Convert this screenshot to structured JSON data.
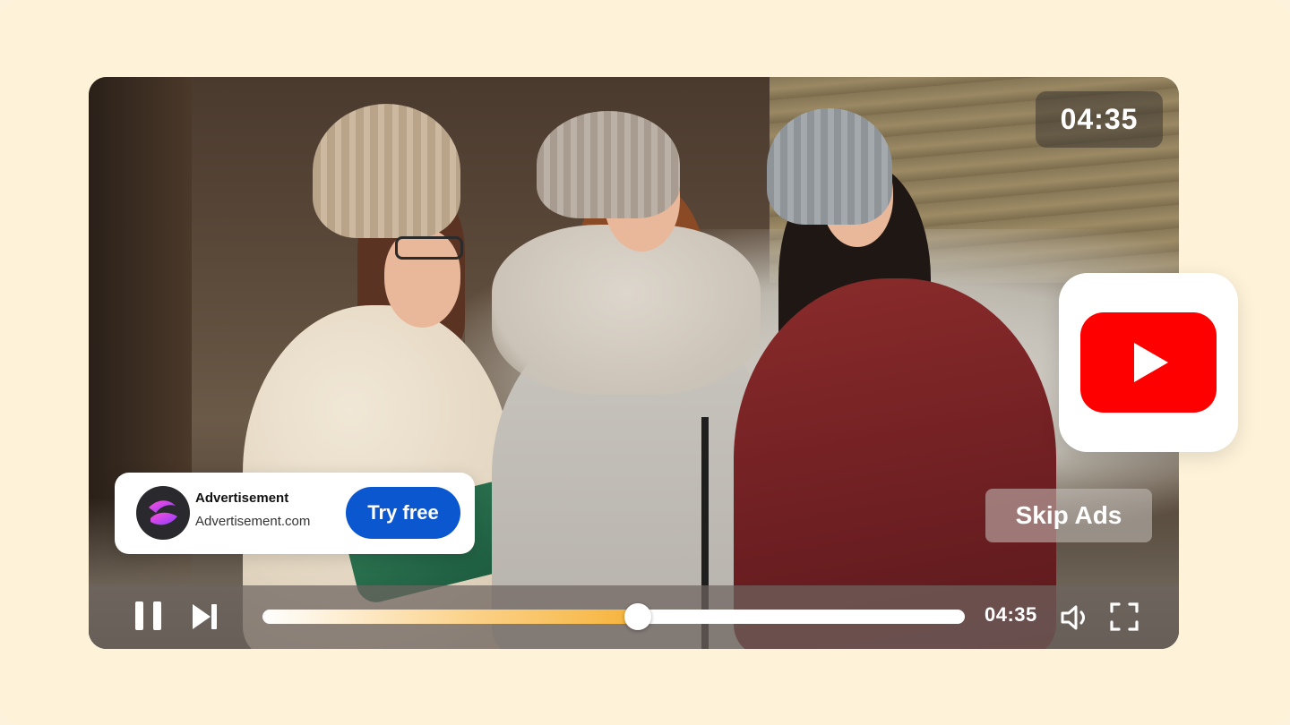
{
  "player": {
    "duration_badge": "04:35",
    "current_time": "04:35",
    "progress_fraction": 0.535,
    "skip_label": "Skip Ads"
  },
  "ad": {
    "title": "Advertisement",
    "url": "Advertisement.com",
    "cta_label": "Try free"
  },
  "colors": {
    "background": "#fef3d9",
    "cta_blue": "#0b57d0",
    "youtube_red": "#ff0000",
    "progress_accent": "#f6b33a"
  },
  "icons": {
    "pause": "pause-icon",
    "next": "skip-next-icon",
    "volume": "volume-icon",
    "fullscreen": "fullscreen-icon",
    "ad_logo": "ad-brand-logo",
    "youtube": "youtube-logo"
  }
}
